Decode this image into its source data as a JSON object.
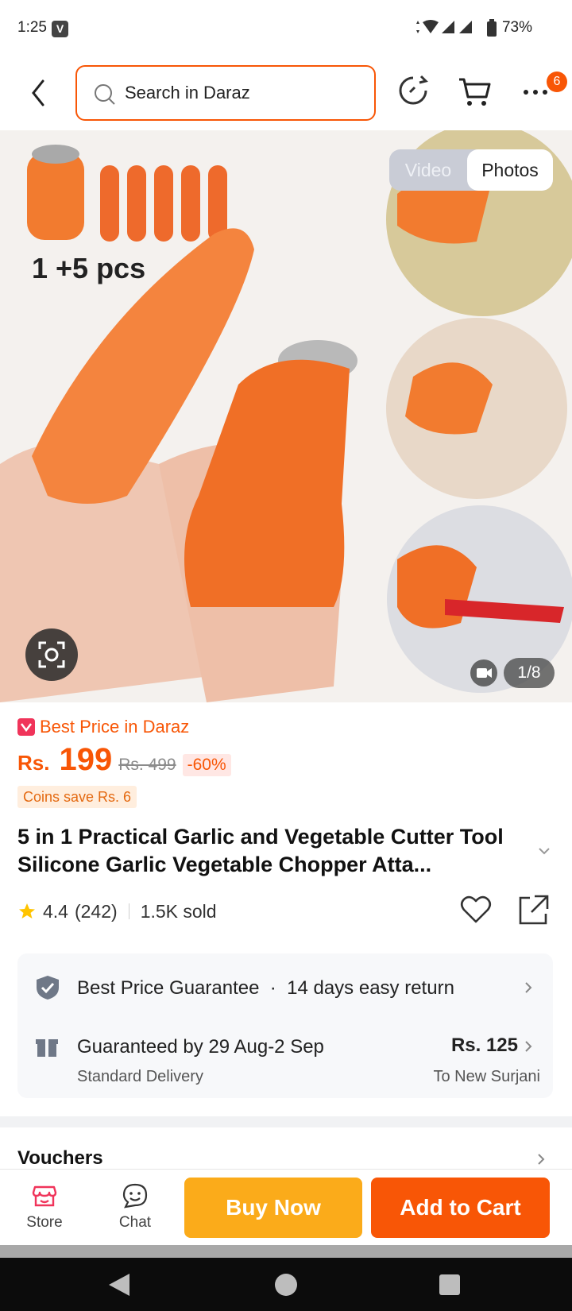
{
  "status_bar": {
    "time": "1:25",
    "app_indicator": "V",
    "battery": "73%"
  },
  "header": {
    "search_placeholder": "Search in Daraz",
    "cart_badge": "6"
  },
  "gallery": {
    "tabs": {
      "video": "Video",
      "photos": "Photos"
    },
    "counter": "1/8",
    "image_caption": "1 +5 pcs"
  },
  "price": {
    "best_price_label": "Best Price in Daraz",
    "currency": "Rs.",
    "current": "199",
    "original": "Rs. 499",
    "discount": "-60%",
    "coins": "Coins save Rs. 6"
  },
  "product": {
    "title": "5 in 1 Practical Garlic and Vegetable Cutter Tool Silicone Garlic Vegetable Chopper Atta...",
    "rating": "4.4",
    "reviews": "(242)",
    "sold": "1.5K sold"
  },
  "service": {
    "guarantee": "Best Price Guarantee",
    "return": "14 days easy return",
    "delivery_date": "Guaranteed by 29 Aug-2 Sep",
    "delivery_type": "Standard Delivery",
    "delivery_price": "Rs. 125",
    "delivery_location": "To New Surjani"
  },
  "vouchers": {
    "label": "Vouchers"
  },
  "bottom_bar": {
    "store": "Store",
    "chat": "Chat",
    "buy_now": "Buy Now",
    "add_to_cart": "Add to Cart"
  },
  "colors": {
    "accent": "#f85606",
    "buy_now": "#fbab1a",
    "star": "#ffc400"
  }
}
